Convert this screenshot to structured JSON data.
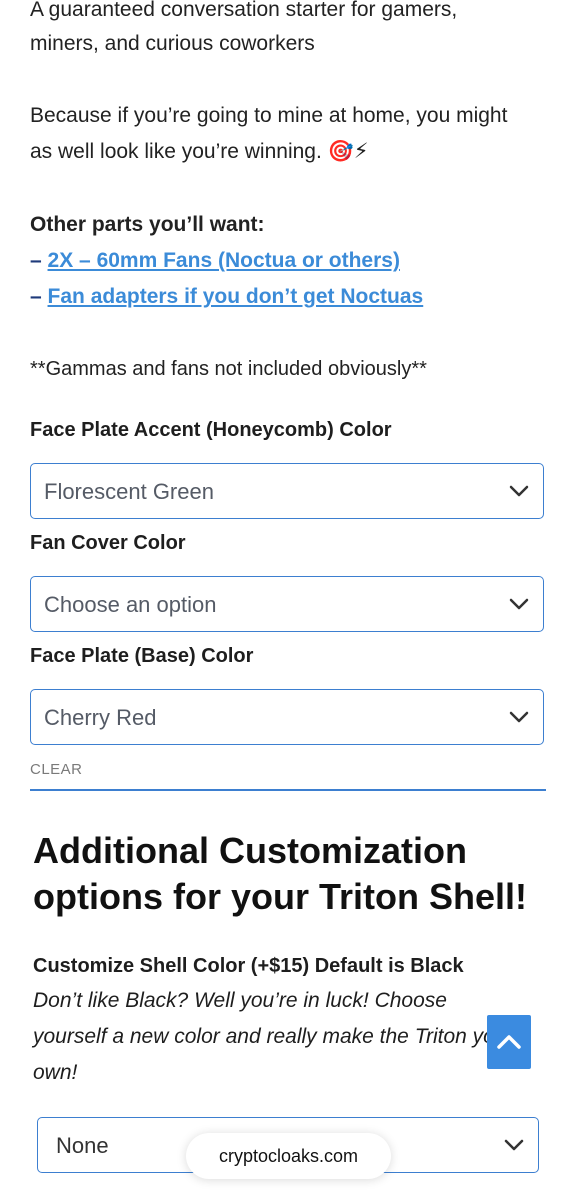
{
  "intro": {
    "line1": "A guaranteed conversation starter for gamers,",
    "line2": "miners, and curious coworkers",
    "line3": "Because if you’re going to mine at home, you might",
    "line4": "as well look like you’re winning. 🎯⚡"
  },
  "other_parts": {
    "title": "Other parts you’ll want:",
    "dash": "–",
    "link1": "2X – 60mm Fans (Noctua or others)",
    "link2": "Fan adapters if you don’t get Noctuas"
  },
  "note": "**Gammas and fans not included obviously**",
  "fields": [
    {
      "label": "Face Plate Accent (Honeycomb) Color",
      "value": "Florescent Green"
    },
    {
      "label": "Fan Cover Color",
      "value": "Choose an option"
    },
    {
      "label": "Face Plate (Base) Color",
      "value": "Cherry Red"
    }
  ],
  "clear_label": "CLEAR",
  "customization": {
    "heading_line1": "Additional Customization",
    "heading_line2": "options for your Triton Shell!",
    "shell_label": "Customize Shell Color (+$15) Default is Black",
    "desc_line1": "Don’t like Black? Well you’re in luck! Choose",
    "desc_line2": "yourself a new color and really make the Triton your",
    "desc_line3": "own!",
    "shell_value": "None"
  },
  "browser": {
    "domain": "cryptocloaks.com"
  },
  "colors": {
    "accent": "#3d7fd0",
    "link": "#3b8bd8",
    "scroll_button": "#3b8be0"
  }
}
